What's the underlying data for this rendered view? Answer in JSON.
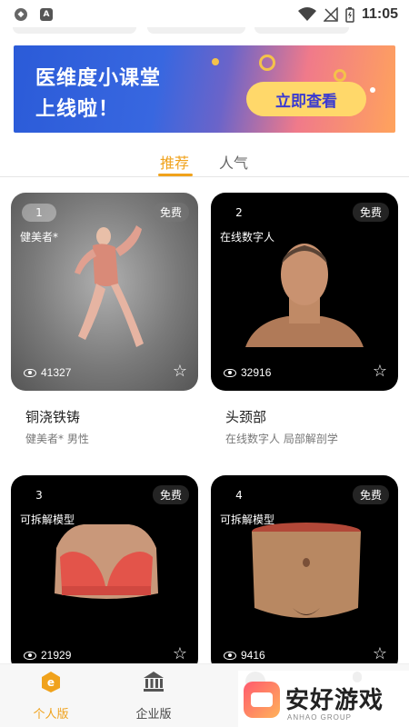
{
  "status_bar": {
    "time": "11:05",
    "left_icons": [
      "shield-icon",
      "a-icon"
    ],
    "right_icons": [
      "wifi-icon",
      "no-signal-icon",
      "battery-icon"
    ]
  },
  "banner": {
    "line1": "医维度小课堂",
    "line2": "上线啦！",
    "button_label": "立即查看"
  },
  "tabs": [
    {
      "label": "推荐",
      "active": true
    },
    {
      "label": "人气",
      "active": false
    }
  ],
  "cards": [
    {
      "rank": "1",
      "badge": "免费",
      "category": "健美者*",
      "views": "41327",
      "title": "铜浇铁铸",
      "subtitle": "健美者* 男性"
    },
    {
      "rank": "2",
      "badge": "免费",
      "category": "在线数字人",
      "views": "32916",
      "title": "头颈部",
      "subtitle": "在线数字人 局部解剖学"
    },
    {
      "rank": "3",
      "badge": "免费",
      "category": "可拆解模型",
      "views": "21929"
    },
    {
      "rank": "4",
      "badge": "免费",
      "category": "可拆解模型",
      "views": "9416"
    }
  ],
  "bottom_nav": [
    {
      "label": "个人版",
      "active": true,
      "icon": "personal-edition-icon"
    },
    {
      "label": "企业版",
      "active": false,
      "icon": "enterprise-building-icon"
    }
  ],
  "watermark": {
    "text": "安好游戏",
    "sub": "ANHAO GROUP"
  },
  "colors": {
    "accent": "#f0a21c",
    "banner_blue": "#2b5bd8",
    "banner_button": "#ffd86a"
  }
}
